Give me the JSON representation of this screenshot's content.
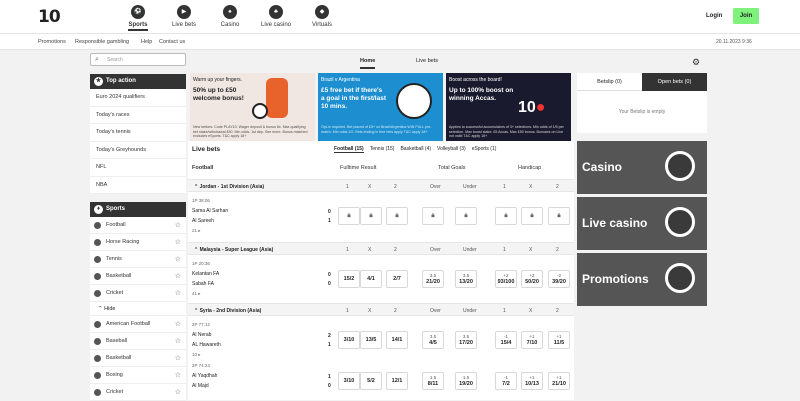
{
  "header": {
    "logo": "10",
    "nav": [
      {
        "label": "Sports",
        "icon": "soccer-icon",
        "active": true
      },
      {
        "label": "Live bets",
        "icon": "live-icon",
        "active": false
      },
      {
        "label": "Casino",
        "icon": "casino-icon",
        "active": false
      },
      {
        "label": "Live casino",
        "icon": "live-casino-icon",
        "active": false
      },
      {
        "label": "Virtuals",
        "icon": "virtuals-icon",
        "active": false
      }
    ],
    "login_label": "Login",
    "join_label": "Join"
  },
  "sublinks": [
    "Promotions",
    "Responsible gambling",
    "Help",
    "Contact us"
  ],
  "datetime": "20.11.2023 9:36",
  "main_tabs": [
    "Home",
    "Live bets"
  ],
  "search": {
    "placeholder": "Search"
  },
  "top_action": {
    "title": "Top action",
    "items": [
      "Euro 2024 qualifiers",
      "Today's races",
      "Today's tennis",
      "Today's Greyhounds",
      "NFL",
      "NBA"
    ]
  },
  "sports": {
    "title": "Sports",
    "items": [
      "Football",
      "Horse Racing",
      "Tennis",
      "Basketball",
      "Cricket"
    ],
    "hide_label": "Hide",
    "more": [
      "American Football",
      "Baseball",
      "Basketball",
      "Boxing",
      "Cricket"
    ]
  },
  "banners": [
    {
      "kicker": "Warm up your fingers.",
      "headline": "50% up to £50 welcome bonus!",
      "small": "New bettors: Code PLAY10. Wager deposit & bonus 8x. Max qualifying bet stake/withdrawal £50. Min odds. 1st dep. See more. Bonus matched excludes eSports. T&C apply 18+"
    },
    {
      "kicker": "Brazil v Argentina",
      "headline": "£5 free bet if there's a goal in the first/last 10 mins.",
      "small": "Opt-in required. Bet placed of £5+ on Brazil/Argentina WIN FULL pre-match. Min odds 1/2. Bets ending in free bets apply T&C apply 18+"
    },
    {
      "kicker": "Boost across the board!",
      "headline": "Up to 100% boost on winning Accas.",
      "small": "Applies to successful accumulators of 3+ selections. Min odds of 1/5 per selection. Max boost stake: £5 Accas. Max £50 bonus. Bonuses on Live not valid T&C apply 18+"
    }
  ],
  "live": {
    "title": "Live bets",
    "sport_tabs": [
      "Football (15)",
      "Tennis (15)",
      "Basketball (4)",
      "Volleyball (3)",
      "eSports (1)"
    ],
    "sport_label": "Football",
    "col_heads": [
      "Fulltime Result",
      "Total Goals",
      "Handicap"
    ],
    "comps": [
      {
        "name": "Jordan - 1st Division (Asia)",
        "heads": [
          "1",
          "X",
          "2",
          "Over",
          "Under",
          "1",
          "X",
          "2"
        ],
        "match": {
          "time": "1P 38:06",
          "home": "Sama Al Sarhan",
          "away": "Al Sareeh",
          "more": "21 ▸",
          "score_home": "0",
          "score_away": "1",
          "odds": [
            "lock",
            "lock",
            "lock",
            "lock",
            "lock",
            "lock",
            "lock",
            "lock"
          ]
        }
      },
      {
        "name": "Malaysia - Super League (Asia)",
        "heads": [
          "1",
          "X",
          "2",
          "Over",
          "Under",
          "1",
          "X",
          "2"
        ],
        "match": {
          "time": "1P 20:36",
          "home": "Kelantan FA",
          "away": "Sabah FA",
          "more": "41 ▸",
          "score_home": "0",
          "score_away": "0",
          "odds": [
            "15/2",
            "4/1",
            "2/7",
            "3.5|21/20",
            "3.5|13/20",
            "+2|93/100",
            "+2|50/20",
            "-2|39/20"
          ]
        }
      },
      {
        "name": "Syria - 2nd Division (Asia)",
        "heads": [
          "1",
          "X",
          "2",
          "Over",
          "Under",
          "1",
          "X",
          "2"
        ],
        "match": {
          "time": "2P 77:12",
          "home": "Al Nerab",
          "away": "AL Hawareth",
          "more": "10 ▸",
          "score_home": "2",
          "score_away": "1",
          "odds": [
            "3/10",
            "13/5",
            "14/1",
            "3.5|4/5",
            "3.5|17/20",
            "-1|15/4",
            "+1|7/10",
            "+1|11/5"
          ]
        }
      },
      {
        "name": "",
        "heads": [],
        "match": {
          "time": "2P 74:24",
          "home": "Al Yaqdhah",
          "away": "Al Majd",
          "more": "",
          "score_home": "1",
          "score_away": "0",
          "odds": [
            "3/10",
            "5/2",
            "12/1",
            "1.5|8/11",
            "1.5|19/20",
            "-1|7/2",
            "+1|10/13",
            "+1|21/10"
          ]
        }
      }
    ]
  },
  "betslip": {
    "tab1": "Betslip (0)",
    "tab2": "Open bets (0)",
    "empty": "Your Betslip is empty"
  },
  "promos": [
    "Casino",
    "Live casino",
    "Promotions"
  ]
}
